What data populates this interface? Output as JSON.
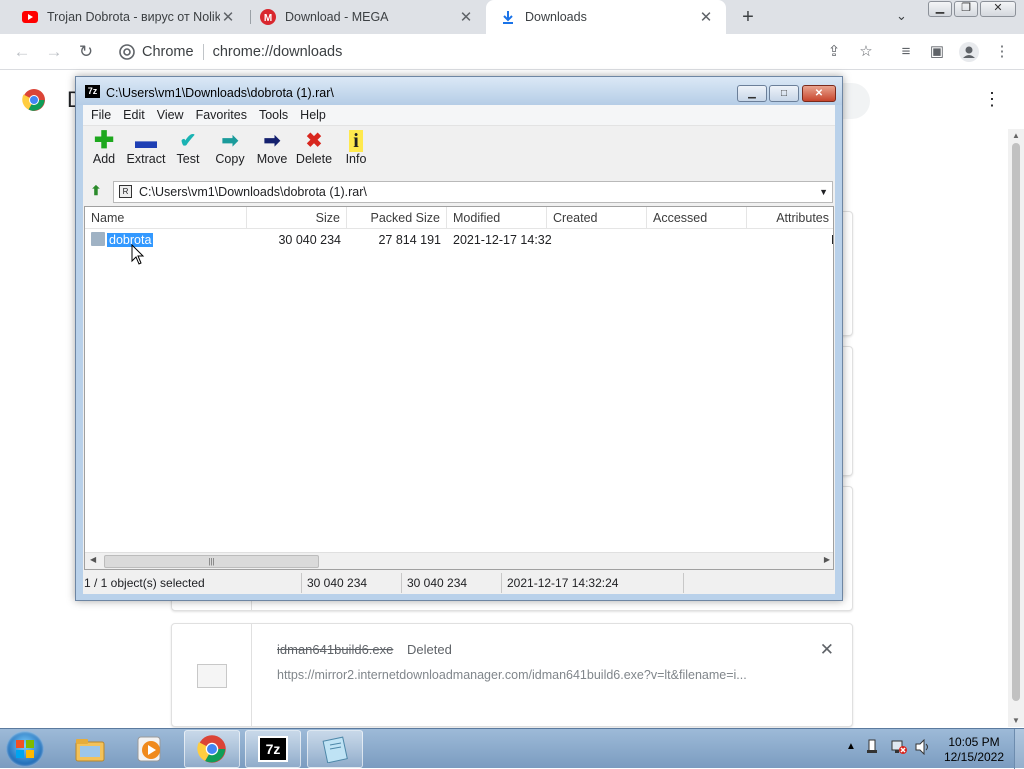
{
  "browser": {
    "tabs": [
      {
        "title": "Trojan Dobrota - вирус от Nolik",
        "icon": "youtube-icon",
        "active": false
      },
      {
        "title": "Download - MEGA",
        "icon": "mega-icon",
        "active": false
      },
      {
        "title": "Downloads",
        "icon": "download-icon",
        "active": true
      }
    ],
    "new_tab": "+",
    "tab_search": "⌄",
    "omnibox": {
      "site_label": "Chrome",
      "url": "chrome://downloads"
    }
  },
  "downloads_page": {
    "title": "D",
    "card": {
      "filename": "idman641build6.exe",
      "status": "Deleted",
      "url": "https://mirror2.internetdownloadmanager.com/idman641build6.exe?v=lt&filename=i..."
    }
  },
  "sevenzip": {
    "title": "C:\\Users\\vm1\\Downloads\\dobrota (1).rar\\",
    "menu": [
      "File",
      "Edit",
      "View",
      "Favorites",
      "Tools",
      "Help"
    ],
    "toolbar": [
      {
        "label": "Add",
        "icon": "add-icon"
      },
      {
        "label": "Extract",
        "icon": "extract-icon"
      },
      {
        "label": "Test",
        "icon": "test-icon"
      },
      {
        "label": "Copy",
        "icon": "copy-icon"
      },
      {
        "label": "Move",
        "icon": "move-icon"
      },
      {
        "label": "Delete",
        "icon": "delete-icon"
      },
      {
        "label": "Info",
        "icon": "info-icon"
      }
    ],
    "address": "C:\\Users\\vm1\\Downloads\\dobrota (1).rar\\",
    "columns": [
      "Name",
      "Size",
      "Packed Size",
      "Modified",
      "Created",
      "Accessed",
      "Attributes"
    ],
    "rows": [
      {
        "name": "dobrota",
        "size": "30 040 234",
        "packed": "27 814 191",
        "modified": "2021-12-17 14:32",
        "created": "",
        "accessed": "",
        "attr": "D"
      }
    ],
    "status": {
      "selected": "1 / 1 object(s) selected",
      "size": "30 040 234",
      "packed": "30 040 234",
      "modified": "2021-12-17 14:32:24"
    }
  },
  "taskbar": {
    "apps": [
      "explorer-icon",
      "media-player-icon",
      "chrome-icon",
      "7zip-icon",
      "notepad-icon"
    ],
    "seven_zip_label": "7z",
    "clock_time": "10:05 PM",
    "clock_date": "12/15/2022"
  }
}
